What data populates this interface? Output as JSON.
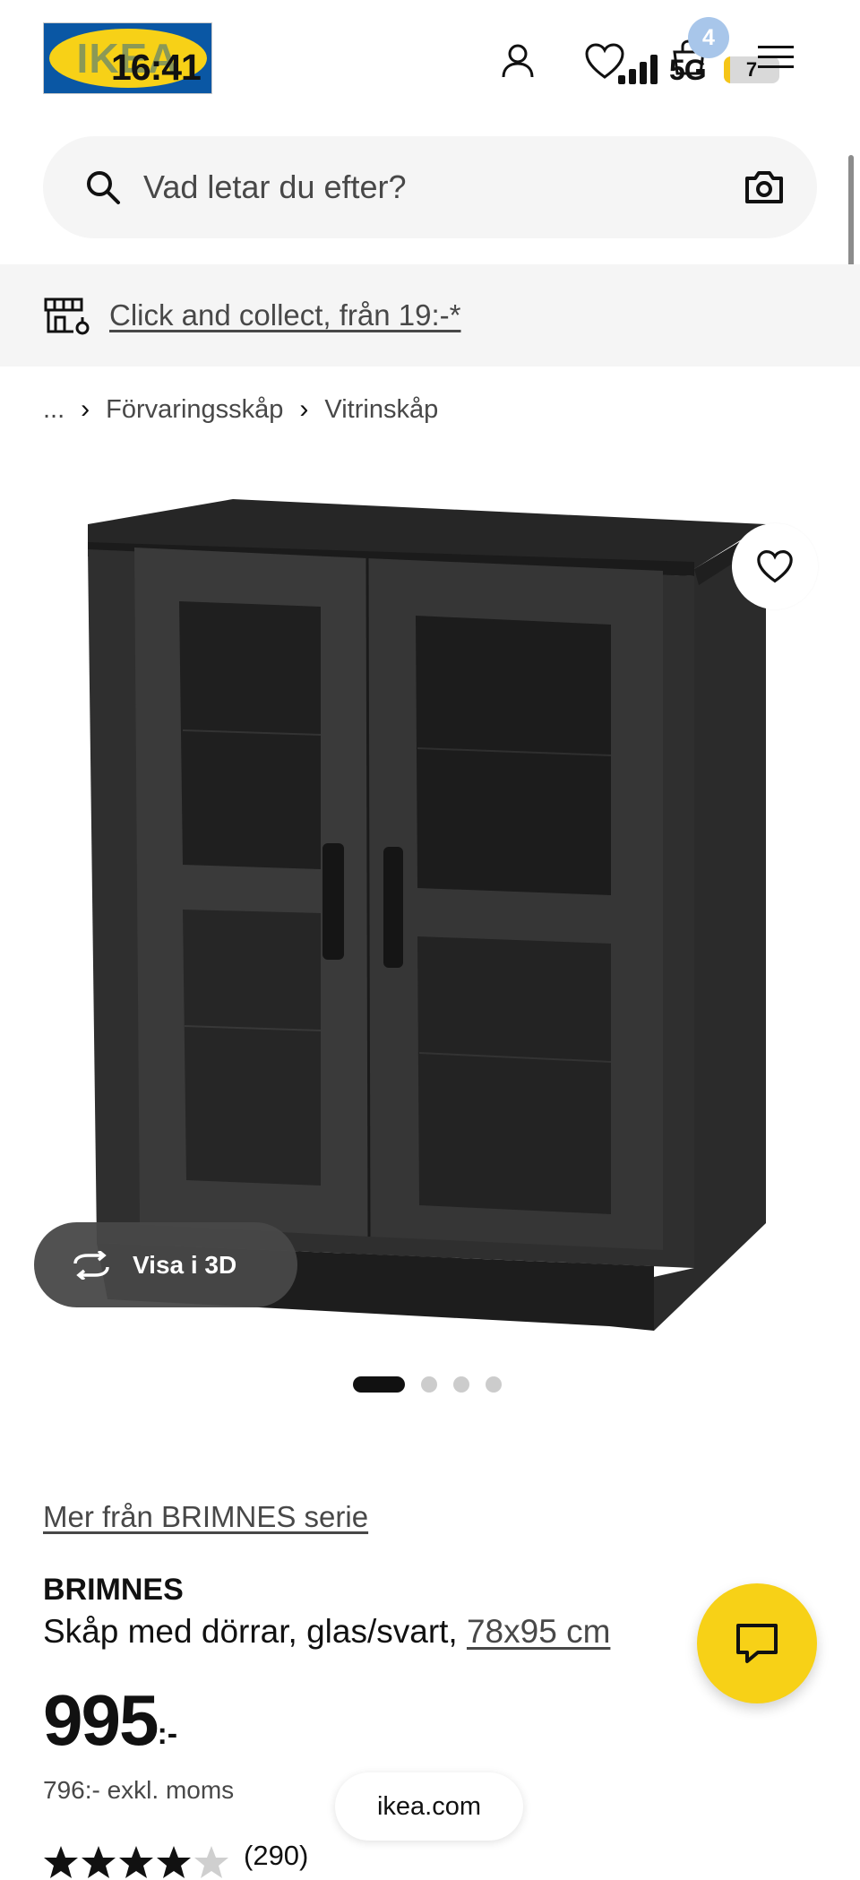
{
  "status_bar": {
    "time": "16:41",
    "network": "5G",
    "battery": "7",
    "battery_level_percent": 7
  },
  "header": {
    "logo_text": "IKEA",
    "account_icon": "person-icon",
    "favorites_icon": "heart-icon",
    "cart_icon": "shopping-bag-icon",
    "cart_count": "4",
    "menu_icon": "hamburger-menu-icon"
  },
  "search": {
    "placeholder": "Vad letar du efter?",
    "camera_icon": "camera-icon"
  },
  "collect_banner": {
    "text": "Click and collect, från 19:-*"
  },
  "breadcrumb": {
    "ellipsis": "...",
    "items": [
      "Förvaringsskåp",
      "Vitrinskåp"
    ]
  },
  "gallery": {
    "visa_3d": "Visa i 3D",
    "image_count": 4,
    "active_index": 0
  },
  "product": {
    "series_link": "Mer från BRIMNES serie",
    "name": "BRIMNES",
    "description": "Skåp med dörrar, glas/svart,",
    "dimensions": "78x95 cm",
    "price": "995",
    "price_suffix": ":-",
    "price_excl": "796:- exkl. moms",
    "rating": 4.5,
    "reviews": "(290)"
  },
  "browser": {
    "domain": "ikea.com"
  },
  "colors": {
    "ikea_yellow": "#f7d117",
    "ikea_blue": "#0a57a4",
    "text": "#111111",
    "muted": "#484848"
  }
}
